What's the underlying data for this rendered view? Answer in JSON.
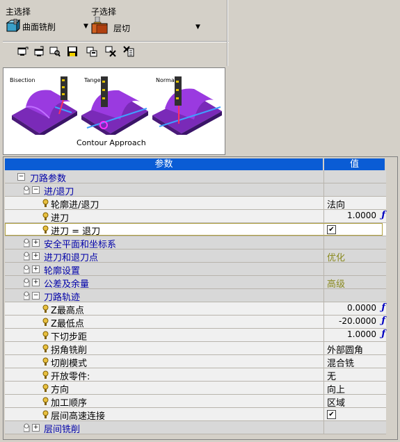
{
  "top": {
    "main_select_label": "主选择",
    "main_select_value": "曲面铣削",
    "sub_select_label": "子选择",
    "sub_select_value": "层切"
  },
  "toolbar": {
    "icons": [
      "new-window-icon",
      "open-icon",
      "search-icon",
      "save-icon",
      "properties-icon",
      "tools-icon",
      "select-icon"
    ]
  },
  "preview": {
    "panels": [
      "Bisection",
      "Tangent",
      "Normal"
    ],
    "caption": "Contour Approach"
  },
  "grid": {
    "header_param": "参数",
    "header_value": "值",
    "rows": [
      {
        "name": "刀路参数",
        "value": ""
      },
      {
        "name": "进/退刀",
        "value": ""
      },
      {
        "name": "轮廓进/退刀",
        "value": "法向"
      },
      {
        "name": "进刀",
        "value": "1.0000"
      },
      {
        "name": "进刀 = 退刀",
        "value": "✔"
      },
      {
        "name": "安全平面和坐标系",
        "value": ""
      },
      {
        "name": "进刀和退刀点",
        "value": "优化"
      },
      {
        "name": "轮廓设置",
        "value": ""
      },
      {
        "name": "公差及余量",
        "value": "高级"
      },
      {
        "name": "刀路轨迹",
        "value": ""
      },
      {
        "name": "Z最高点",
        "value": "0.0000"
      },
      {
        "name": "Z最低点",
        "value": "-20.0000"
      },
      {
        "name": "下切步距",
        "value": "1.0000"
      },
      {
        "name": "拐角铣削",
        "value": "外部圆角"
      },
      {
        "name": "切削模式",
        "value": "混合铣"
      },
      {
        "name": "开放零件:",
        "value": "无"
      },
      {
        "name": "方向",
        "value": "向上"
      },
      {
        "name": "加工顺序",
        "value": "区域"
      },
      {
        "name": "层间高速连接",
        "value": "✔"
      },
      {
        "name": "层间铣削",
        "value": ""
      }
    ]
  },
  "colors": {
    "header_bg": "#0a5cd5",
    "tree_text": "#0000a8",
    "advanced_text": "#8a8a20",
    "function_icon": "#0000c0"
  }
}
